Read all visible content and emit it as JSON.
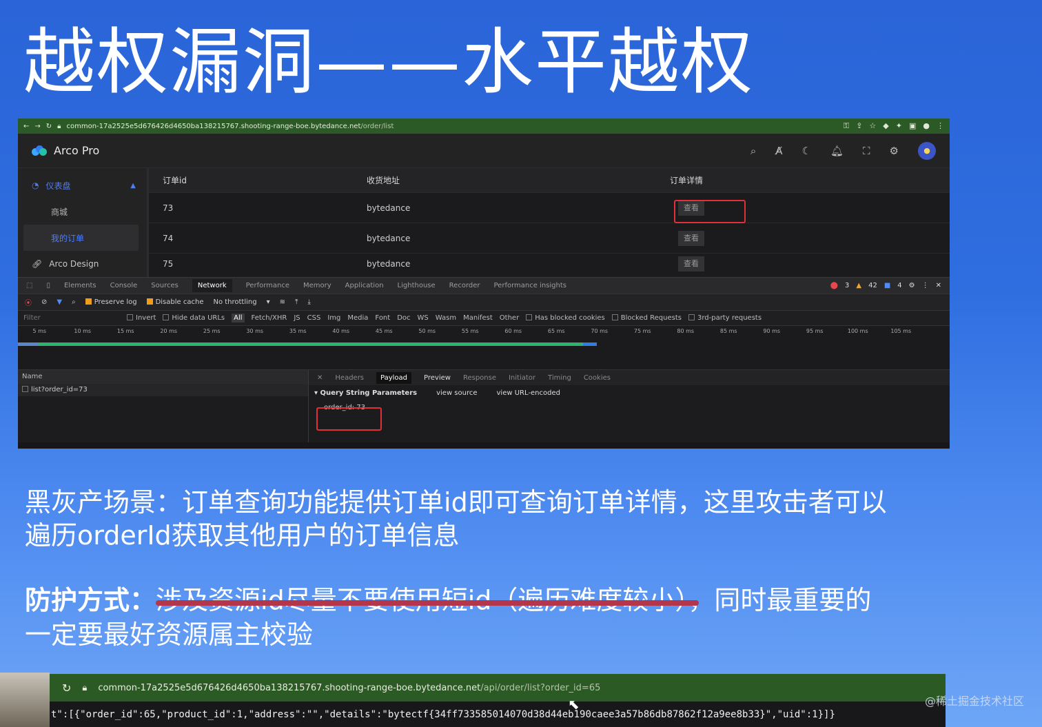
{
  "slide": {
    "title": "越权漏洞——水平越权",
    "scenario_label": "黑灰产场景：",
    "scenario_line1": "订单查询功能提供订单id即可查询订单详情，这里攻击者可以",
    "scenario_line2": "遍历orderId获取其他用户的订单信息",
    "defense_label": "防护方式：",
    "defense_struck": "涉及资源id尽量不要使用短id（遍历难度较小）",
    "defense_rest": "，同时最重要的",
    "defense_line2": "一定要最好资源属主校验",
    "watermark": "@稀土掘金技术社区"
  },
  "browser": {
    "url_host": "common-17a2525e5d676426d4650ba138215767.shooting-range-boe.bytedance.net",
    "url_path": "/order/list"
  },
  "app": {
    "name": "Arco Pro",
    "sidebar": {
      "group": "仪表盘",
      "items": [
        "商城",
        "我的订单"
      ],
      "other": "Arco Design"
    },
    "table": {
      "headers": [
        "订单id",
        "收货地址",
        "订单详情"
      ],
      "rows": [
        {
          "id": "73",
          "address": "bytedance",
          "action": "查看"
        },
        {
          "id": "74",
          "address": "bytedance",
          "action": "查看"
        },
        {
          "id": "75",
          "address": "bytedance",
          "action": "查看"
        }
      ]
    }
  },
  "devtools": {
    "tabs": [
      "Elements",
      "Console",
      "Sources",
      "Network",
      "Performance",
      "Memory",
      "Application",
      "Lighthouse",
      "Recorder",
      "Performance insights"
    ],
    "active_tab": "Network",
    "errors": "3",
    "warnings": "42",
    "messages": "4",
    "toolbar": {
      "preserve_log": "Preserve log",
      "disable_cache": "Disable cache",
      "throttling": "No throttling"
    },
    "filter": {
      "placeholder": "Filter",
      "invert": "Invert",
      "hide_data": "Hide data URLs",
      "types": [
        "All",
        "Fetch/XHR",
        "JS",
        "CSS",
        "Img",
        "Media",
        "Font",
        "Doc",
        "WS",
        "Wasm",
        "Manifest",
        "Other"
      ],
      "blocked_cookies": "Has blocked cookies",
      "blocked_requests": "Blocked Requests",
      "third_party": "3rd-party requests"
    },
    "ticks": [
      "5 ms",
      "10 ms",
      "15 ms",
      "20 ms",
      "25 ms",
      "30 ms",
      "35 ms",
      "40 ms",
      "45 ms",
      "50 ms",
      "55 ms",
      "60 ms",
      "65 ms",
      "70 ms",
      "75 ms",
      "80 ms",
      "85 ms",
      "90 ms",
      "95 ms",
      "100 ms",
      "105 ms"
    ],
    "name_header": "Name",
    "request": "list?order_id=73",
    "detail_tabs": [
      "Headers",
      "Payload",
      "Preview",
      "Response",
      "Initiator",
      "Timing",
      "Cookies"
    ],
    "active_detail": "Payload",
    "query_title": "Query String Parameters",
    "view_source": "view source",
    "view_url": "view URL-encoded",
    "param": "order_id: 73"
  },
  "bottom": {
    "url_host": "common-17a2525e5d676426d4650ba138215767.shooting-range-boe.bytedance.net",
    "url_path": "/api/order/list?order_id=65",
    "json": "t\":[{\"order_id\":65,\"product_id\":1,\"address\":\"\",\"details\":\"bytectf{34ff733585014070d38d44eb190caee3a57b86db87862f12a9ee8b33}\",\"uid\":1}]}"
  }
}
